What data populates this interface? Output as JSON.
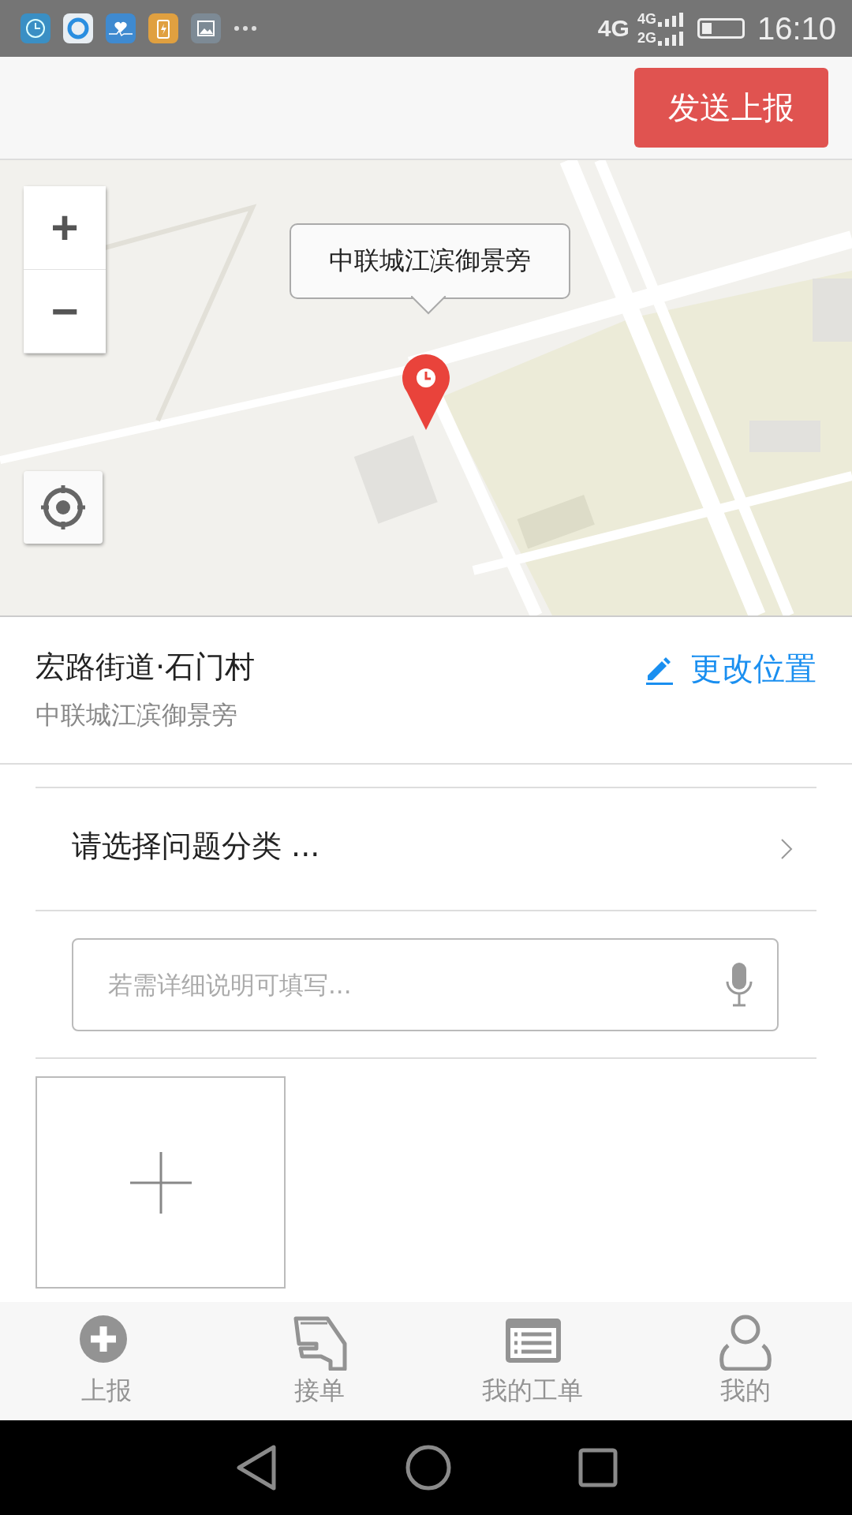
{
  "status_bar": {
    "network": "4G",
    "sim_1": "4G",
    "sim_2": "2G",
    "time": "16:10",
    "battery": {
      "level": 0.25
    }
  },
  "header": {
    "send_button": "发送上报"
  },
  "map": {
    "callout": "中联城江滨御景旁",
    "zoom_in": "+",
    "zoom_out": "−"
  },
  "location": {
    "title": "宏路街道·石门村",
    "subtitle": "中联城江滨御景旁",
    "change_link": "更改位置"
  },
  "category": {
    "placeholder": "请选择问题分类 ..."
  },
  "description": {
    "placeholder": "若需详细说明可填写..."
  },
  "bottom_nav": [
    {
      "kind": "report",
      "label": "上报",
      "selected": false
    },
    {
      "kind": "accept",
      "label": "接单",
      "selected": false
    },
    {
      "kind": "orders",
      "label": "我的工单",
      "selected": false
    },
    {
      "kind": "me",
      "label": "我的",
      "selected": false
    }
  ]
}
